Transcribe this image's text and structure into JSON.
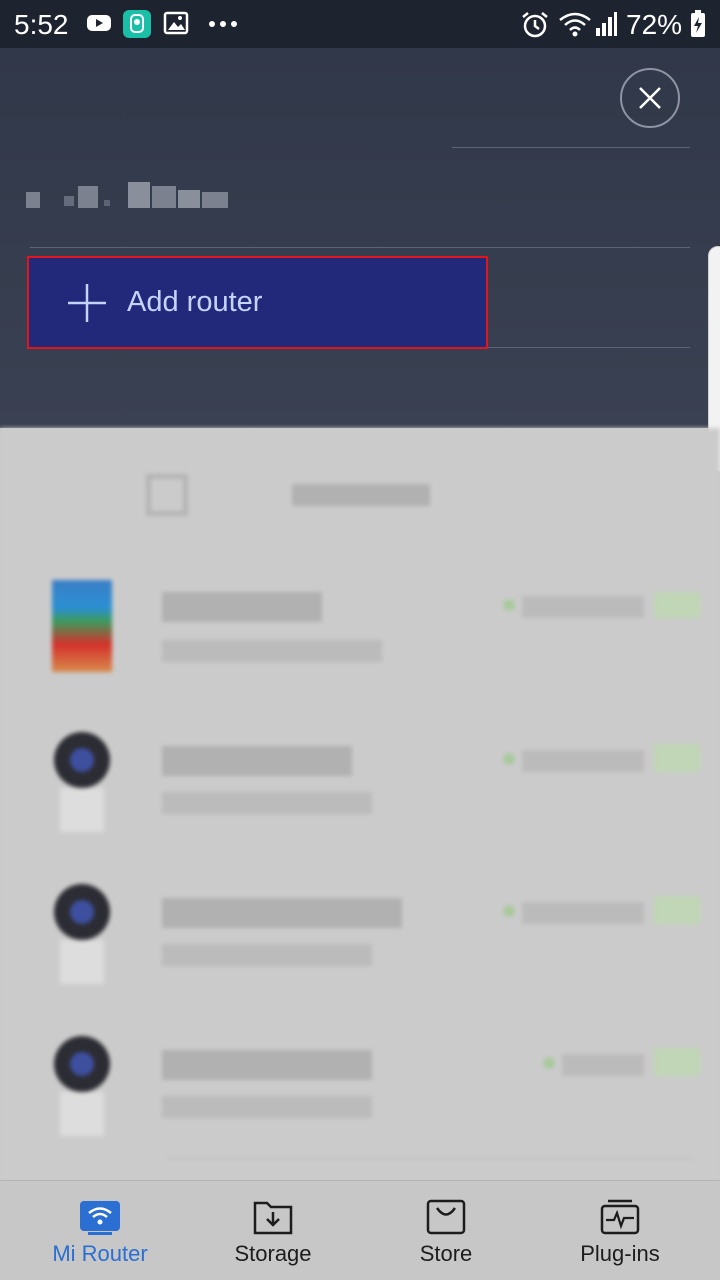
{
  "status_bar": {
    "time": "5:52",
    "battery_percent": "72%"
  },
  "panel": {
    "add_router_label": "Add router",
    "add_router_highlight": "#e0161b"
  },
  "bottom_nav": {
    "items": [
      {
        "label": "Mi Router",
        "icon": "wifi-router-icon",
        "active": true
      },
      {
        "label": "Storage",
        "icon": "storage-download-icon",
        "active": false
      },
      {
        "label": "Store",
        "icon": "shopping-bag-icon",
        "active": false
      },
      {
        "label": "Plug-ins",
        "icon": "plugins-pulse-icon",
        "active": false
      }
    ]
  },
  "colors": {
    "accent": "#2a6fd1",
    "panel_bg": "#313849",
    "add_router_bg": "#22287a"
  }
}
